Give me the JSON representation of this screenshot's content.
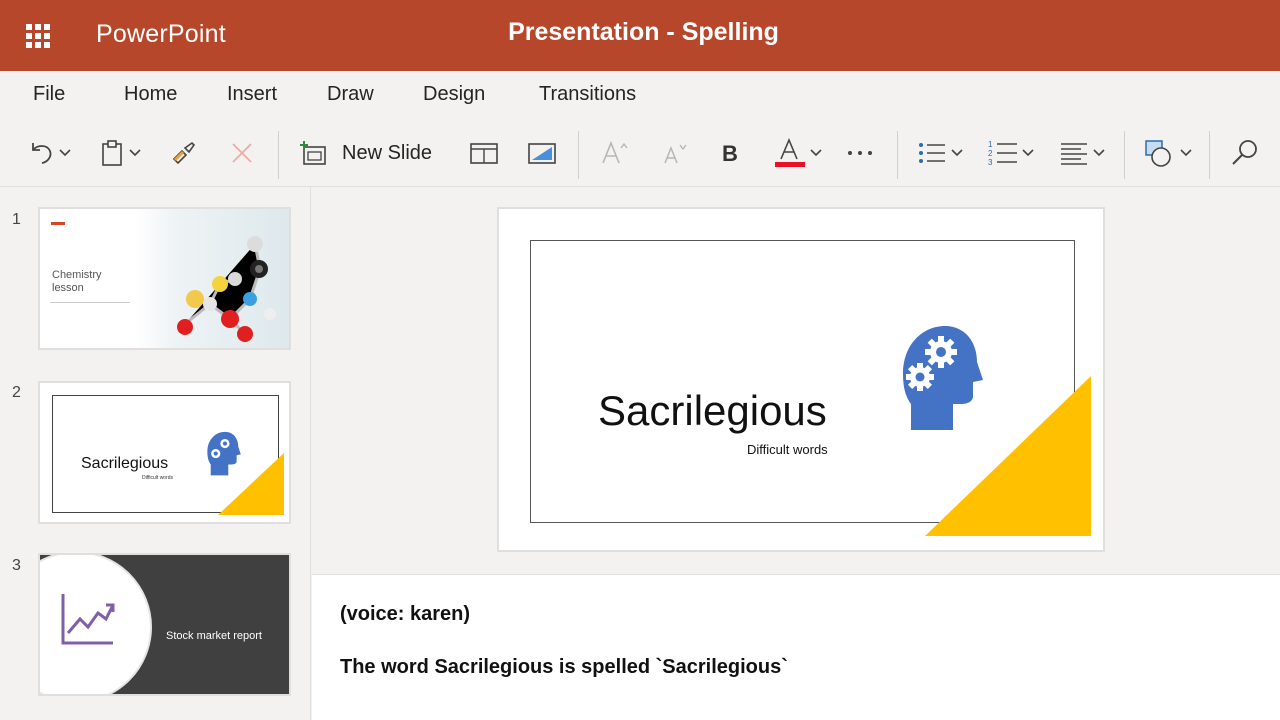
{
  "app": {
    "name": "PowerPoint",
    "title": "Presentation - Spelling",
    "brand_color": "#b7472a"
  },
  "tabs": [
    {
      "label": "File"
    },
    {
      "label": "Home"
    },
    {
      "label": "Insert"
    },
    {
      "label": "Draw"
    },
    {
      "label": "Design"
    },
    {
      "label": "Transitions"
    }
  ],
  "ribbon": {
    "new_slide_label": "New Slide",
    "icons": [
      "undo-icon",
      "clipboard-icon",
      "format-painter-icon",
      "delete-icon",
      "new-slide-icon",
      "layout-icon",
      "background-icon",
      "grow-font-icon",
      "shrink-font-icon",
      "bold-icon",
      "font-color-icon",
      "more-icon",
      "bullets-icon",
      "numbering-icon",
      "align-icon",
      "shapes-icon",
      "search-icon"
    ],
    "font_color": "#e81123"
  },
  "thumbnails": [
    {
      "number": "1",
      "title": "Chemistry\nlesson",
      "accent": "#d24726"
    },
    {
      "number": "2",
      "title": "Sacrilegious",
      "subtitle": "Difficult words"
    },
    {
      "number": "3",
      "title": "Stock market report"
    }
  ],
  "slide": {
    "title": "Sacrilegious",
    "subtitle": "Difficult words",
    "icon_color": "#4472c4",
    "triangle_color": "#ffc000"
  },
  "notes": {
    "line1": "(voice: karen)",
    "line2": "The word Sacrilegious is spelled `Sacrilegious`"
  }
}
